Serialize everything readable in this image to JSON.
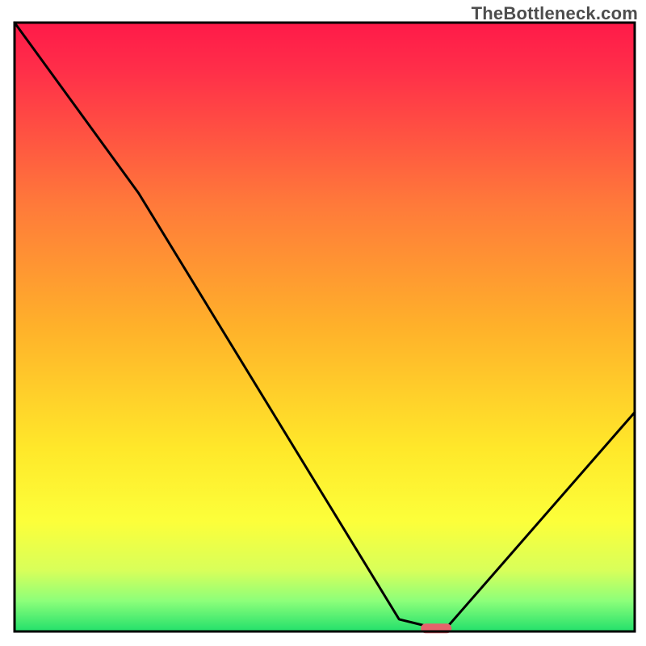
{
  "watermark": "TheBottleneck.com",
  "chart_data": {
    "type": "line",
    "title": "",
    "xlabel": "",
    "ylabel": "",
    "xlim": [
      0,
      100
    ],
    "ylim": [
      0,
      100
    ],
    "series": [
      {
        "name": "bottleneck-curve",
        "x": [
          0,
          20,
          62,
          66,
          70,
          100
        ],
        "values": [
          100,
          72,
          2,
          1,
          1,
          36
        ]
      }
    ],
    "annotations": [
      {
        "name": "optimal-marker",
        "x": 68,
        "y": 0.5,
        "color": "#e5636b"
      }
    ],
    "gradient_stops": [
      {
        "offset": 0.0,
        "color": "#ff1a49"
      },
      {
        "offset": 0.08,
        "color": "#ff2f49"
      },
      {
        "offset": 0.3,
        "color": "#ff7a3a"
      },
      {
        "offset": 0.5,
        "color": "#ffb12a"
      },
      {
        "offset": 0.7,
        "color": "#ffe82a"
      },
      {
        "offset": 0.82,
        "color": "#fcff3a"
      },
      {
        "offset": 0.9,
        "color": "#d8ff5a"
      },
      {
        "offset": 0.95,
        "color": "#8cff7a"
      },
      {
        "offset": 1.0,
        "color": "#22e06b"
      }
    ],
    "legend": null,
    "grid": false
  }
}
